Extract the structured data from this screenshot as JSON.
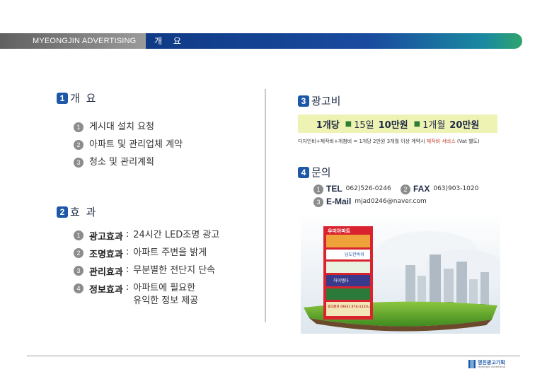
{
  "header": {
    "brand": "MYEONGJIN ADVERTISING",
    "title": "개 요"
  },
  "sections": {
    "overview": {
      "badge": "1",
      "title": "개 요",
      "items": [
        {
          "num": "1",
          "text": "게시대 설치 요청"
        },
        {
          "num": "2",
          "text": "아파트 및 관리업체 계약"
        },
        {
          "num": "3",
          "text": "청소 및 관리계획"
        }
      ]
    },
    "effects": {
      "badge": "2",
      "title": "효 과",
      "items": [
        {
          "num": "1",
          "label": "광고효과",
          "text": "24시간 LED조명 광고"
        },
        {
          "num": "2",
          "label": "조명효과",
          "text": "아파트 주변을 밝게"
        },
        {
          "num": "3",
          "label": "관리효과",
          "text": "무분별한 전단지 단속"
        },
        {
          "num": "4",
          "label": "정보효과",
          "text": "아파트에 필요한",
          "text2": "유익한 정보 제공"
        }
      ]
    },
    "price": {
      "badge": "3",
      "title": "광고비",
      "unit": "1개당",
      "days": "15일",
      "days_price": "10만원",
      "month": "1개월",
      "month_price": "20만원",
      "note_prefix": "디자인비+제작비+게첨비 = 1개당 2만원 3개월 이상 계약시 ",
      "note_highlight": "제작비 서비스",
      "note_suffix": " (Vat 별도)"
    },
    "contact": {
      "badge": "4",
      "title": "문의",
      "tel_num": "1",
      "tel_label": "TEL",
      "tel": "062)526-0246",
      "fax_num": "2",
      "fax_label": "FAX",
      "fax": "063)903-1020",
      "mail_num": "3",
      "mail_label": "E-Mail",
      "mail": "mjad0246@naver.com"
    }
  },
  "illustration": {
    "sign_title": "우미아파트",
    "panel_1": "남도한바위",
    "panel_2": "하이멤다",
    "panel_3": "광고문의 (062) 374-1123,4"
  },
  "logo": {
    "text": "명진광고기획",
    "sub": "Myeongjin Advertising"
  }
}
